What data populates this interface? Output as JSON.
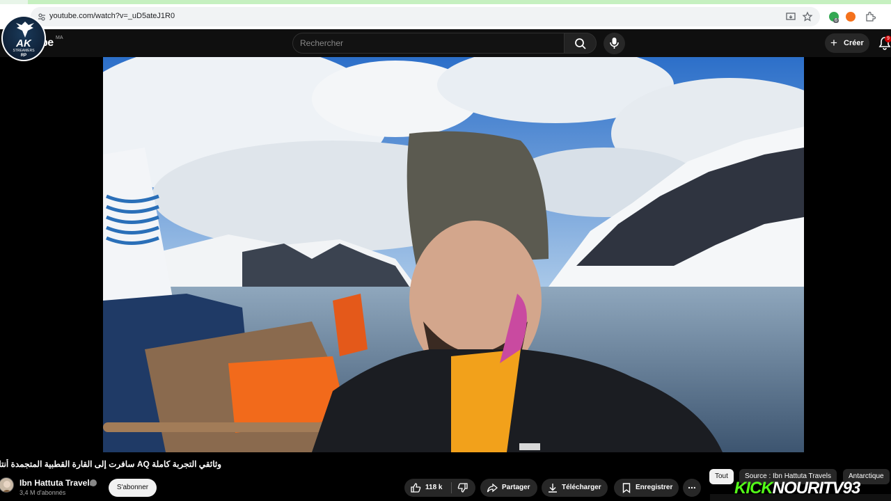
{
  "browser": {
    "url": "youtube.com/watch?v=_uD5ateJ1R0",
    "extension_badge": "6"
  },
  "channel_logo": {
    "text": "AK",
    "subtext": "STREAMERS",
    "subtext2": "RP"
  },
  "youtube": {
    "logo_text": "be",
    "region": "MA",
    "search_placeholder": "Rechercher",
    "create_label": "Créer",
    "notification_count": "9"
  },
  "video": {
    "title": "وثائقي التجربة كاملة AQ سافرت إلى القارة القطبية المتجمدة أنتاركتيكا",
    "channel_name": "Ibn Hattuta Travels",
    "subscribers": "3,4 M d'abonnés",
    "subscribe_label": "S'abonner"
  },
  "actions": {
    "like_count": "118 k",
    "share_label": "Partager",
    "download_label": "Télécharger",
    "save_label": "Enregistrer",
    "more_label": "..."
  },
  "chips": [
    "Tout",
    "Source : Ibn Hattuta Travels",
    "Antarctique"
  ],
  "overlay": {
    "kick_brand": "KICK",
    "kick_channel": "NOURITV93"
  },
  "colors": {
    "background": "#000000",
    "toolbar": "#0f0f0f",
    "pill": "#272727",
    "kick_green": "#53fc18"
  }
}
